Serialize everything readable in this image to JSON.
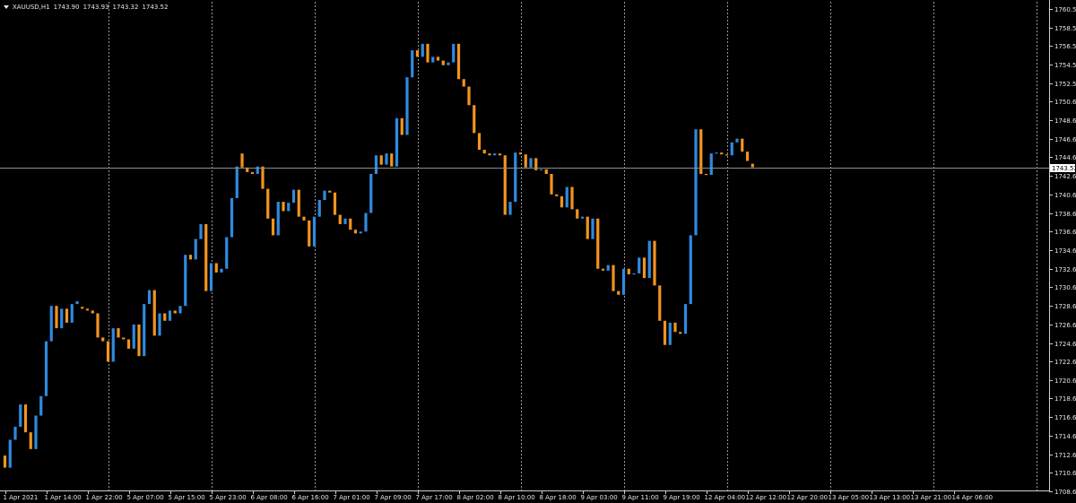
{
  "header": {
    "symbol": "XAUUSD,H1",
    "open": "1743.90",
    "high": "1743.93",
    "low": "1743.32",
    "close": "1743.52"
  },
  "price_marker": "1743.52",
  "colors": {
    "bull": "#2f8ae0",
    "bear": "#f2941e",
    "grid": "#9a9a9a",
    "axis": "#cfcfcf",
    "text": "#e6e6e6"
  },
  "chart_data": {
    "type": "candlestick",
    "title": "XAUUSD,H1",
    "y_ticks": [
      "1760.55",
      "1758.55",
      "1756.55",
      "1754.55",
      "1752.55",
      "1750.60",
      "1748.60",
      "1746.60",
      "1744.60",
      "1742.60",
      "1740.60",
      "1738.60",
      "1736.60",
      "1734.60",
      "1732.60",
      "1730.60",
      "1728.60",
      "1726.60",
      "1724.60",
      "1722.60",
      "1720.65",
      "1718.65",
      "1716.65",
      "1714.65",
      "1712.65",
      "1710.65",
      "1708.65"
    ],
    "ylim": [
      1708.65,
      1760.55
    ],
    "x_ticks": [
      "1 Apr 2021",
      "1 Apr 14:00",
      "1 Apr 22:00",
      "5 Apr 07:00",
      "5 Apr 15:00",
      "5 Apr 23:00",
      "6 Apr 08:00",
      "6 Apr 16:00",
      "7 Apr 01:00",
      "7 Apr 09:00",
      "7 Apr 17:00",
      "8 Apr 02:00",
      "8 Apr 10:00",
      "8 Apr 18:00",
      "9 Apr 03:00",
      "9 Apr 11:00",
      "9 Apr 19:00",
      "12 Apr 04:00",
      "12 Apr 12:00",
      "12 Apr 20:00",
      "13 Apr 05:00",
      "13 Apr 13:00",
      "13 Apr 21:00",
      "14 Apr 06:00"
    ],
    "current_price": 1743.52,
    "ohlc": [
      [
        1712.5,
        1712.8,
        1711.0,
        1711.2
      ],
      [
        1711.2,
        1714.5,
        1711.0,
        1714.2
      ],
      [
        1714.2,
        1716.0,
        1713.8,
        1715.6
      ],
      [
        1715.6,
        1718.2,
        1715.3,
        1718.0
      ],
      [
        1718.0,
        1718.1,
        1714.8,
        1715.0
      ],
      [
        1715.0,
        1715.1,
        1713.0,
        1713.2
      ],
      [
        1713.2,
        1717.0,
        1713.0,
        1716.8
      ],
      [
        1716.8,
        1719.0,
        1716.5,
        1718.9
      ],
      [
        1718.9,
        1725.0,
        1718.5,
        1724.8
      ],
      [
        1724.8,
        1728.9,
        1724.5,
        1728.6
      ],
      [
        1728.6,
        1728.8,
        1726.0,
        1726.2
      ],
      [
        1726.2,
        1728.5,
        1726.0,
        1728.3
      ],
      [
        1728.3,
        1728.4,
        1726.5,
        1726.8
      ],
      [
        1726.8,
        1729.0,
        1726.6,
        1728.8
      ],
      [
        1728.8,
        1729.3,
        1728.5,
        1729.1
      ],
      [
        1728.5,
        1728.6,
        1728.2,
        1728.3
      ],
      [
        1728.3,
        1728.4,
        1728.0,
        1728.1
      ],
      [
        1728.1,
        1728.2,
        1727.6,
        1727.8
      ],
      [
        1727.8,
        1727.9,
        1725.0,
        1725.2
      ],
      [
        1725.2,
        1725.3,
        1724.6,
        1724.8
      ],
      [
        1724.8,
        1724.9,
        1722.4,
        1722.6
      ],
      [
        1722.6,
        1726.5,
        1722.4,
        1726.2
      ],
      [
        1726.2,
        1726.3,
        1725.0,
        1725.2
      ],
      [
        1725.2,
        1725.4,
        1724.8,
        1725.0
      ],
      [
        1725.0,
        1725.1,
        1723.9,
        1724.0
      ],
      [
        1724.0,
        1726.9,
        1723.8,
        1726.6
      ],
      [
        1726.6,
        1726.7,
        1722.9,
        1723.2
      ],
      [
        1723.2,
        1729.0,
        1723.0,
        1728.8
      ],
      [
        1728.8,
        1730.5,
        1728.5,
        1730.3
      ],
      [
        1730.3,
        1730.4,
        1725.2,
        1725.4
      ],
      [
        1725.4,
        1728.0,
        1725.2,
        1727.8
      ],
      [
        1727.8,
        1728.2,
        1726.5,
        1727.0
      ],
      [
        1727.0,
        1728.4,
        1726.8,
        1728.1
      ],
      [
        1728.1,
        1728.2,
        1727.5,
        1727.8
      ],
      [
        1727.8,
        1729.0,
        1727.6,
        1728.6
      ],
      [
        1728.6,
        1734.3,
        1728.5,
        1734.1
      ],
      [
        1734.1,
        1734.4,
        1733.2,
        1733.6
      ],
      [
        1733.6,
        1736.2,
        1733.4,
        1735.8
      ],
      [
        1735.8,
        1737.7,
        1735.5,
        1737.4
      ],
      [
        1737.4,
        1737.5,
        1730.0,
        1730.2
      ],
      [
        1730.2,
        1733.5,
        1730.0,
        1733.2
      ],
      [
        1733.2,
        1733.3,
        1732.0,
        1732.2
      ],
      [
        1732.2,
        1732.8,
        1732.0,
        1732.6
      ],
      [
        1732.6,
        1736.2,
        1732.4,
        1736.0
      ],
      [
        1736.0,
        1740.5,
        1735.8,
        1740.2
      ],
      [
        1740.2,
        1745.3,
        1740.0,
        1743.6
      ],
      [
        1745.0,
        1745.3,
        1743.2,
        1743.5
      ],
      [
        1743.5,
        1743.6,
        1742.7,
        1743.0
      ],
      [
        1743.0,
        1743.3,
        1742.5,
        1742.8
      ],
      [
        1742.8,
        1743.8,
        1742.6,
        1743.6
      ],
      [
        1743.6,
        1743.8,
        1741.0,
        1741.2
      ],
      [
        1741.2,
        1741.3,
        1737.8,
        1738.0
      ],
      [
        1738.0,
        1739.5,
        1736.0,
        1736.2
      ],
      [
        1736.2,
        1740.0,
        1736.0,
        1739.8
      ],
      [
        1739.8,
        1739.9,
        1738.5,
        1738.8
      ],
      [
        1738.8,
        1740.0,
        1738.5,
        1739.7
      ],
      [
        1739.7,
        1741.3,
        1739.5,
        1741.1
      ],
      [
        1741.1,
        1741.2,
        1735.2,
        1738.2
      ],
      [
        1738.2,
        1738.3,
        1737.5,
        1737.8
      ],
      [
        1737.8,
        1738.0,
        1734.8,
        1735.0
      ],
      [
        1735.0,
        1738.5,
        1734.8,
        1738.2
      ],
      [
        1738.2,
        1740.2,
        1738.0,
        1740.0
      ],
      [
        1740.0,
        1741.2,
        1739.8,
        1741.0
      ],
      [
        1741.0,
        1741.4,
        1740.5,
        1740.8
      ],
      [
        1740.8,
        1740.9,
        1738.2,
        1738.4
      ],
      [
        1738.4,
        1738.5,
        1737.2,
        1737.4
      ],
      [
        1737.4,
        1738.2,
        1737.2,
        1738.0
      ],
      [
        1738.0,
        1738.1,
        1736.5,
        1736.8
      ],
      [
        1736.8,
        1737.2,
        1736.2,
        1736.4
      ],
      [
        1736.4,
        1736.8,
        1736.0,
        1736.6
      ],
      [
        1736.6,
        1738.8,
        1736.4,
        1738.6
      ],
      [
        1738.6,
        1743.0,
        1738.4,
        1742.8
      ],
      [
        1742.8,
        1745.0,
        1742.6,
        1744.8
      ],
      [
        1744.8,
        1745.0,
        1743.6,
        1743.8
      ],
      [
        1743.8,
        1745.2,
        1743.5,
        1745.0
      ],
      [
        1745.0,
        1745.1,
        1743.4,
        1743.6
      ],
      [
        1743.6,
        1749.0,
        1743.4,
        1748.8
      ],
      [
        1748.8,
        1749.0,
        1746.8,
        1747.0
      ],
      [
        1747.0,
        1753.5,
        1746.8,
        1753.2
      ],
      [
        1753.2,
        1756.3,
        1753.0,
        1756.1
      ],
      [
        1756.1,
        1756.3,
        1755.2,
        1755.4
      ],
      [
        1755.4,
        1757.0,
        1755.2,
        1756.8
      ],
      [
        1756.8,
        1757.2,
        1754.6,
        1754.8
      ],
      [
        1754.8,
        1755.6,
        1754.6,
        1755.4
      ],
      [
        1755.4,
        1755.5,
        1754.8,
        1755.0
      ],
      [
        1755.0,
        1755.1,
        1754.3,
        1754.5
      ],
      [
        1754.5,
        1755.0,
        1754.3,
        1754.8
      ],
      [
        1754.8,
        1757.0,
        1754.6,
        1756.8
      ],
      [
        1756.8,
        1757.0,
        1752.8,
        1753.0
      ],
      [
        1753.0,
        1753.2,
        1752.0,
        1752.2
      ],
      [
        1752.2,
        1752.4,
        1750.0,
        1750.2
      ],
      [
        1750.2,
        1750.4,
        1747.0,
        1747.2
      ],
      [
        1747.2,
        1747.4,
        1745.2,
        1745.4
      ],
      [
        1745.4,
        1745.6,
        1744.8,
        1745.0
      ],
      [
        1745.0,
        1745.1,
        1744.7,
        1744.8
      ],
      [
        1744.8,
        1745.2,
        1744.5,
        1745.0
      ],
      [
        1745.0,
        1745.2,
        1744.6,
        1744.8
      ],
      [
        1744.8,
        1745.0,
        1738.2,
        1738.4
      ],
      [
        1738.4,
        1745.4,
        1738.2,
        1739.8
      ],
      [
        1739.8,
        1745.3,
        1739.6,
        1745.1
      ],
      [
        1745.1,
        1745.3,
        1744.8,
        1744.9
      ],
      [
        1744.9,
        1745.0,
        1743.3,
        1743.5
      ],
      [
        1743.5,
        1744.8,
        1743.3,
        1744.5
      ],
      [
        1744.5,
        1744.6,
        1743.0,
        1743.2
      ],
      [
        1743.2,
        1743.6,
        1743.0,
        1743.3
      ],
      [
        1743.3,
        1743.4,
        1742.5,
        1742.8
      ],
      [
        1742.8,
        1743.0,
        1740.4,
        1740.6
      ],
      [
        1740.6,
        1740.7,
        1740.2,
        1740.4
      ],
      [
        1740.4,
        1740.5,
        1739.0,
        1739.2
      ],
      [
        1739.2,
        1741.6,
        1739.0,
        1741.4
      ],
      [
        1741.4,
        1741.5,
        1738.8,
        1739.0
      ],
      [
        1739.0,
        1739.2,
        1737.8,
        1738.0
      ],
      [
        1738.0,
        1738.4,
        1737.8,
        1738.2
      ],
      [
        1738.2,
        1738.3,
        1735.6,
        1735.8
      ],
      [
        1735.8,
        1738.2,
        1735.6,
        1738.0
      ],
      [
        1738.0,
        1738.2,
        1732.4,
        1732.6
      ],
      [
        1732.6,
        1732.8,
        1732.2,
        1732.4
      ],
      [
        1732.4,
        1733.2,
        1732.2,
        1733.0
      ],
      [
        1733.0,
        1733.2,
        1730.0,
        1730.2
      ],
      [
        1730.2,
        1730.4,
        1729.6,
        1729.8
      ],
      [
        1729.8,
        1732.8,
        1729.6,
        1732.6
      ],
      [
        1732.6,
        1732.7,
        1731.8,
        1732.0
      ],
      [
        1732.0,
        1732.2,
        1731.6,
        1732.1
      ],
      [
        1732.1,
        1734.0,
        1731.9,
        1733.8
      ],
      [
        1733.8,
        1733.9,
        1731.4,
        1731.6
      ],
      [
        1731.6,
        1735.8,
        1731.4,
        1735.6
      ],
      [
        1735.6,
        1735.7,
        1730.6,
        1730.8
      ],
      [
        1730.8,
        1730.9,
        1726.8,
        1727.0
      ],
      [
        1727.0,
        1727.1,
        1724.2,
        1724.4
      ],
      [
        1724.4,
        1727.0,
        1724.2,
        1726.8
      ],
      [
        1726.8,
        1727.0,
        1725.6,
        1725.8
      ],
      [
        1725.8,
        1726.2,
        1725.4,
        1725.6
      ],
      [
        1725.6,
        1729.0,
        1725.4,
        1728.8
      ],
      [
        1728.8,
        1736.5,
        1728.6,
        1736.2
      ],
      [
        1736.2,
        1748.0,
        1736.0,
        1747.6
      ],
      [
        1747.6,
        1748.0,
        1742.6,
        1742.8
      ],
      [
        1742.8,
        1743.0,
        1742.4,
        1742.7
      ],
      [
        1742.7,
        1745.2,
        1742.5,
        1745.0
      ],
      [
        1745.0,
        1745.2,
        1744.8,
        1745.1
      ],
      [
        1745.1,
        1745.2,
        1744.8,
        1744.9
      ],
      [
        1744.9,
        1745.0,
        1744.7,
        1744.8
      ],
      [
        1744.8,
        1746.5,
        1744.6,
        1746.2
      ],
      [
        1746.2,
        1746.8,
        1746.0,
        1746.6
      ],
      [
        1746.6,
        1746.8,
        1745.0,
        1745.2
      ],
      [
        1745.2,
        1745.4,
        1744.0,
        1744.2
      ],
      [
        1743.9,
        1743.93,
        1743.32,
        1743.52
      ]
    ]
  }
}
